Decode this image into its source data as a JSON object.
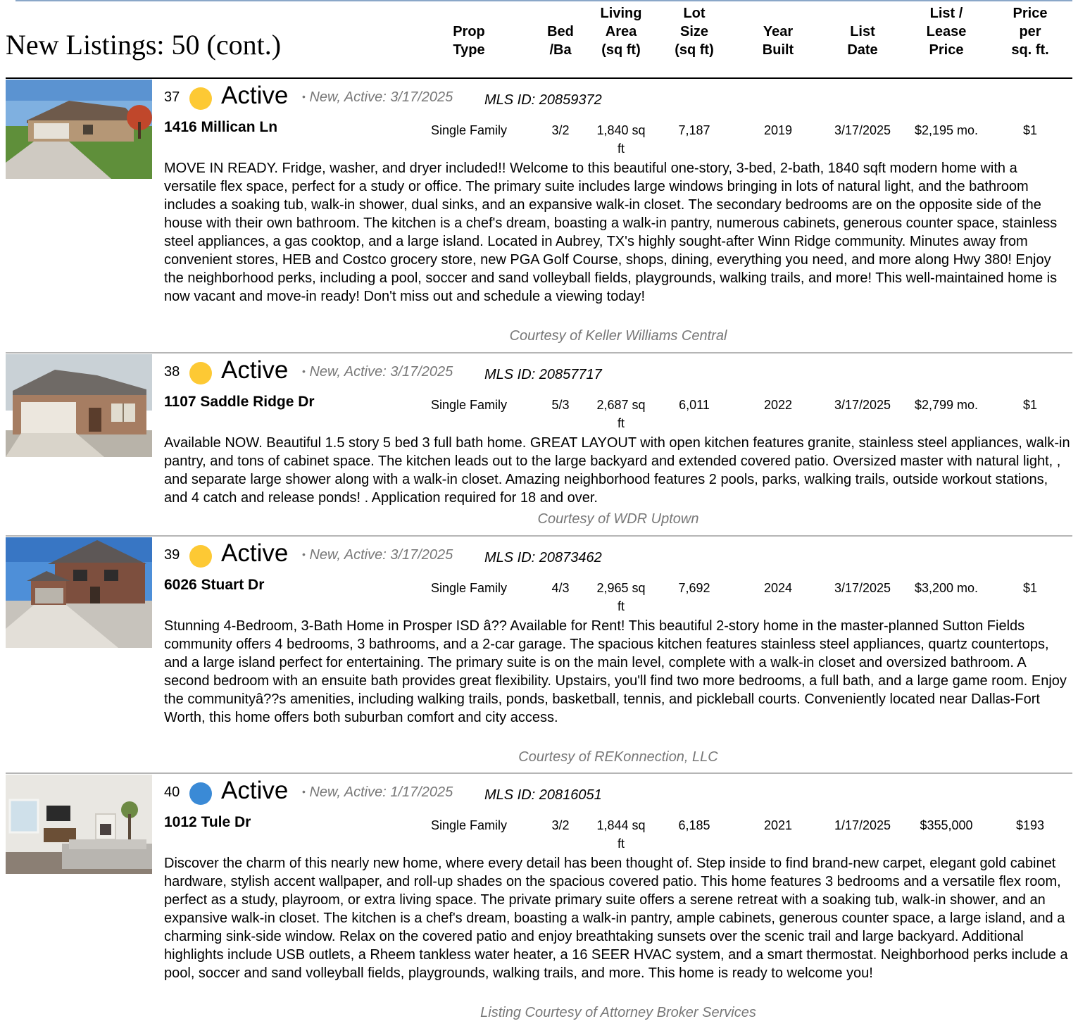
{
  "header": {
    "title": "New Listings: 50 (cont.)",
    "columns": [
      {
        "key": "prop_type",
        "label": "Prop\nType"
      },
      {
        "key": "bed_ba",
        "label": "Bed\n/Ba"
      },
      {
        "key": "living",
        "label": "Living\nArea\n(sq ft)"
      },
      {
        "key": "lot",
        "label": "Lot\nSize\n(sq ft)"
      },
      {
        "key": "year",
        "label": "Year\nBuilt"
      },
      {
        "key": "list_date",
        "label": "List\nDate"
      },
      {
        "key": "price",
        "label": "List /\nLease\nPrice"
      },
      {
        "key": "ppsf",
        "label": "Price\nper\nsq. ft."
      }
    ]
  },
  "colors": {
    "status_yellow": "#fdc934",
    "status_blue": "#3a8ad6",
    "muted_text": "#777777",
    "divider": "#b5b5b5"
  },
  "listings": [
    {
      "number": "37",
      "status_color": "yellow",
      "status": "Active",
      "new_note": "New, Active: 3/17/2025",
      "mls": "MLS ID: 20859372",
      "address": "1416 Millican Ln",
      "prop_type": "Single Family",
      "bed_ba": "3/2",
      "living": "1,840 sq ft",
      "lot": "7,187",
      "year": "2019",
      "list_date": "3/17/2025",
      "price": "$2,195 mo.",
      "ppsf": "$1",
      "description": "MOVE IN READY. Fridge, washer, and dryer included!! Welcome to this beautiful one-story, 3-bed, 2-bath, 1840 sqft modern home with a versatile flex space, perfect for a study or office. The primary suite includes large windows bringing in lots of natural light, and the bathroom includes a soaking tub, walk-in shower, dual sinks, and an expansive walk-in closet. The secondary bedrooms are on the opposite side of the house with their own bathroom. The kitchen is a chef's dream, boasting a walk-in pantry, numerous cabinets, generous counter space, stainless steel appliances, a gas cooktop, and a large island. Located in Aubrey, TX's highly sought-after Winn Ridge community. Minutes away from convenient stores, HEB and Costco grocery store, new PGA Golf Course, shops, dining, everything you need, and more along Hwy 380! Enjoy the neighborhood perks, including a pool, soccer and sand volleyball fields, playgrounds, walking trails, and more! This well-maintained home is now vacant and move-in ready! Don't miss out and schedule a viewing today!",
      "courtesy": "Courtesy of Keller Williams Central",
      "photo_icon": "one-story-house-photo"
    },
    {
      "number": "38",
      "status_color": "yellow",
      "status": "Active",
      "new_note": "New, Active: 3/17/2025",
      "mls": "MLS ID: 20857717",
      "address": "1107 Saddle Ridge Dr",
      "prop_type": "Single Family",
      "bed_ba": "5/3",
      "living": "2,687 sq ft",
      "lot": "6,011",
      "year": "2022",
      "list_date": "3/17/2025",
      "price": "$2,799 mo.",
      "ppsf": "$1",
      "description": "Available NOW. Beautiful 1.5 story 5 bed 3 full bath home. GREAT LAYOUT with open kitchen features granite, stainless steel appliances, walk-in pantry, and tons of cabinet space. The kitchen leads out to the large backyard and extended covered patio. Oversized master with natural light, , and separate large shower along with a walk-in closet. Amazing neighborhood features 2 pools, parks, walking trails, outside workout stations, and 4 catch and release ponds! . Application required for 18 and over.",
      "courtesy": "Courtesy of WDR Uptown",
      "photo_icon": "brick-house-photo"
    },
    {
      "number": "39",
      "status_color": "yellow",
      "status": "Active",
      "new_note": "New, Active: 3/17/2025",
      "mls": "MLS ID: 20873462",
      "address": "6026 Stuart Dr",
      "prop_type": "Single Family",
      "bed_ba": "4/3",
      "living": "2,965 sq ft",
      "lot": "7,692",
      "year": "2024",
      "list_date": "3/17/2025",
      "price": "$3,200 mo.",
      "ppsf": "$1",
      "description": "Stunning 4-Bedroom, 3-Bath Home in Prosper ISD â?? Available for Rent! This beautiful 2-story home in the master-planned Sutton Fields community offers 4 bedrooms, 3 bathrooms, and a 2-car garage. The spacious kitchen features stainless steel appliances, quartz countertops, and a large island perfect for entertaining. The primary suite is on the main level, complete with a walk-in closet and oversized bathroom. A second bedroom with an ensuite bath provides great flexibility. Upstairs, you'll find two more bedrooms, a full bath, and a large game room. Enjoy the communityâ??s amenities, including walking trails, ponds, basketball, tennis, and pickleball courts. Conveniently located near Dallas-Fort Worth, this home offers both suburban comfort and city access.",
      "courtesy": "Courtesy of REKonnection, LLC",
      "photo_icon": "two-story-house-photo"
    },
    {
      "number": "40",
      "status_color": "blue",
      "status": "Active",
      "new_note": "New, Active: 1/17/2025",
      "mls": "MLS ID: 20816051",
      "address": "1012 Tule Dr",
      "prop_type": "Single Family",
      "bed_ba": "3/2",
      "living": "1,844 sq ft",
      "lot": "6,185",
      "year": "2021",
      "list_date": "1/17/2025",
      "price": "$355,000",
      "ppsf": "$193",
      "description": "Discover the charm of this nearly new home, where every detail has been thought of. Step inside to find brand-new carpet, elegant gold cabinet hardware, stylish accent wallpaper, and roll-up shades on the spacious covered patio. This home features 3 bedrooms and a versatile flex room, perfect as a study, playroom, or extra living space. The private primary suite offers a serene retreat with a soaking tub, walk-in shower, and an expansive walk-in closet. The kitchen is a chef's dream, boasting a walk-in pantry, ample cabinets, generous counter space, a large island, and a charming sink-side window. Relax on the covered patio and enjoy breathtaking sunsets over the scenic trail and large backyard. Additional highlights include USB outlets, a Rheem tankless water heater, a 16 SEER HVAC system, and a smart thermostat. Neighborhood perks include a pool, soccer and sand volleyball fields, playgrounds, walking trails, and more. This home is ready to welcome you!",
      "courtesy": "Listing Courtesy of Attorney Broker Services",
      "photo_icon": "living-room-photo"
    }
  ]
}
